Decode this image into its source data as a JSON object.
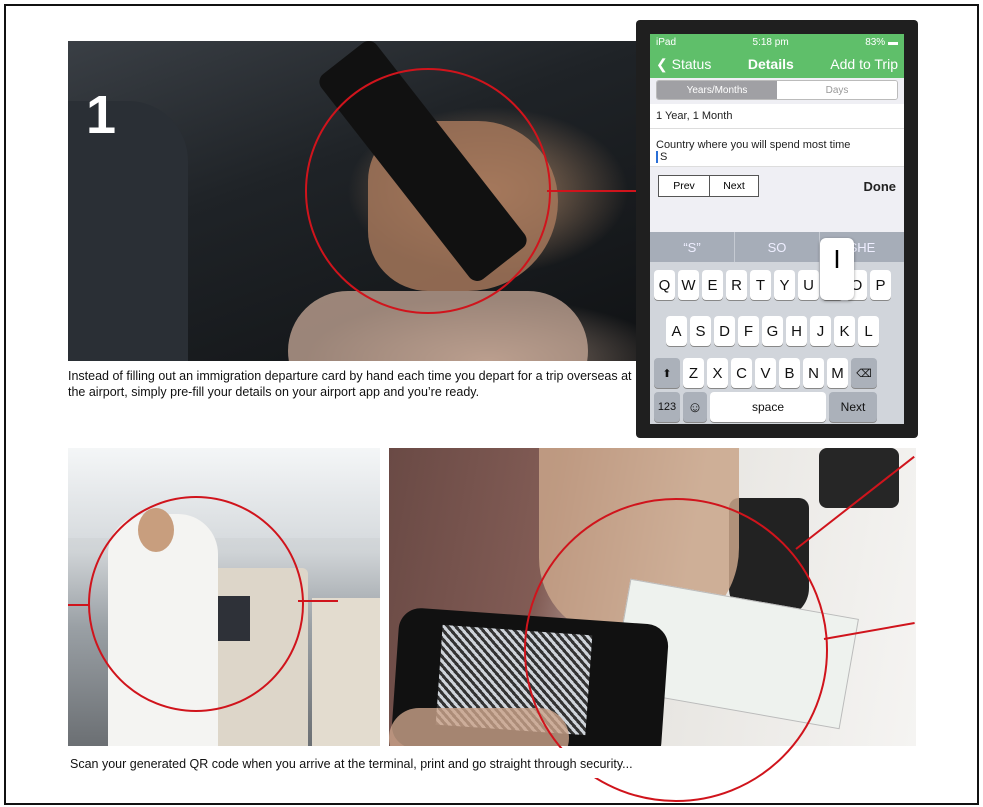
{
  "step_number": "1",
  "caption_top": "Instead of filling out an immigration departure card by hand each time you depart for a trip overseas at the airport, simply pre-fill your details on your airport app and you’re ready.",
  "caption_bottom": "Scan your generated QR code when you arrive at the terminal, print and go straight through security...",
  "ipad": {
    "status_bar": {
      "device": "iPad",
      "time": "5:18 pm",
      "battery": "83%"
    },
    "nav": {
      "back_label": "Status",
      "title": "Details",
      "action_label": "Add to Trip"
    },
    "segment": {
      "selected": "Years/Months",
      "other": "Days"
    },
    "duration_value": "1 Year, 1 Month",
    "country_field": {
      "label": "Country where you will spend most time",
      "value": "S"
    },
    "accessory": {
      "prev_label": "Prev",
      "next_label": "Next",
      "done_label": "Done"
    },
    "suggestions": [
      "“S”",
      "SO",
      "SHE"
    ],
    "keyboard": {
      "row1": [
        "Q",
        "W",
        "E",
        "R",
        "T",
        "Y",
        "U",
        "I",
        "O",
        "P"
      ],
      "row2": [
        "A",
        "S",
        "D",
        "F",
        "G",
        "H",
        "J",
        "K",
        "L"
      ],
      "row3": [
        "Z",
        "X",
        "C",
        "V",
        "B",
        "N",
        "M"
      ],
      "numbers_label": "123",
      "space_label": "space",
      "return_label": "Next",
      "popup_key": "I"
    }
  },
  "colors": {
    "accent_green": "#5fbf6a",
    "highlight_red": "#d0141c"
  }
}
